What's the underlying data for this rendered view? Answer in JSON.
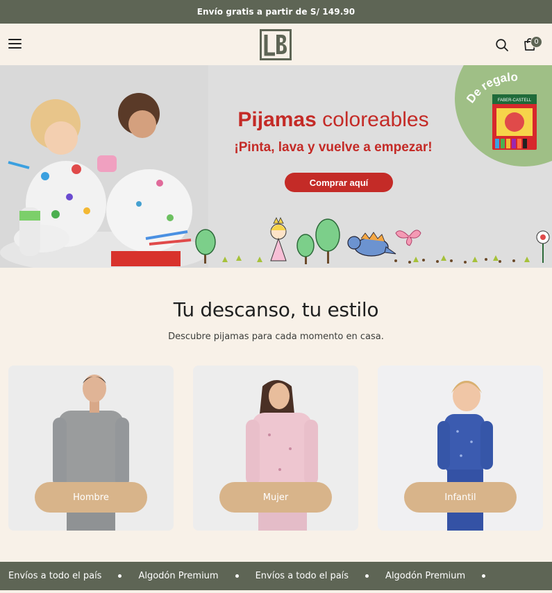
{
  "announcement": {
    "text": "Envío gratis a partir de S/ 149.90"
  },
  "header": {
    "logo_text": "LB",
    "cart_count": "0"
  },
  "icons": {
    "menu": "hamburger-menu-icon",
    "search": "search-icon",
    "cart": "shopping-bag-icon"
  },
  "hero": {
    "title_bold": "Pijamas",
    "title_rest": "coloreables",
    "subtitle": "¡Pinta, lava y vuelve a empezar!",
    "cta_label": "Comprar aquí",
    "badge_text": "De regalo",
    "product_brand": "FABER-CASTELL",
    "colors": {
      "red": "#c42b27",
      "badge_green": "#9fbf86"
    }
  },
  "intro": {
    "title": "Tu descanso, tu estilo",
    "subtitle": "Descubre pijamas para cada momento en casa."
  },
  "categories": [
    {
      "label": "Hombre"
    },
    {
      "label": "Mujer"
    },
    {
      "label": "Infantil"
    }
  ],
  "marquee": {
    "items": [
      "Envíos a todo el país",
      "Algodón Premium",
      "Envíos a todo el país",
      "Algodón Premium"
    ]
  },
  "colors": {
    "olive": "#5e6555",
    "cream": "#f8f1e8",
    "tan": "#d8b48a"
  }
}
